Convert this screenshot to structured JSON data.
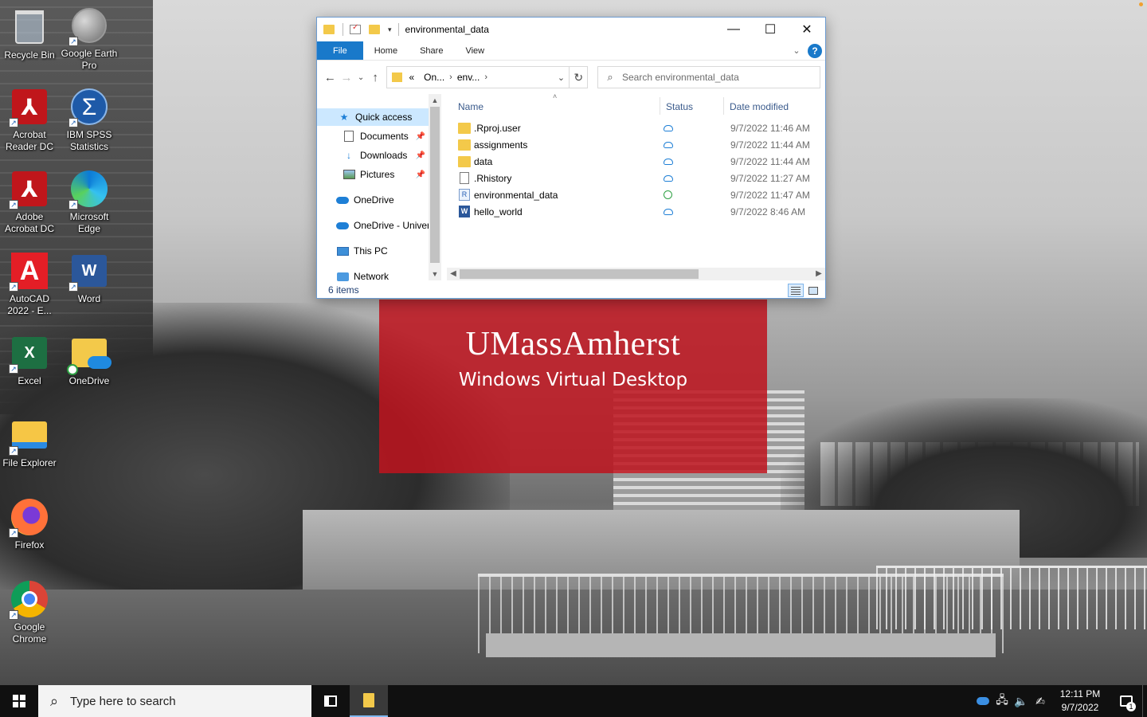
{
  "wallpaper": {
    "brand": "UMassAmherst",
    "subtitle": "Windows Virtual Desktop",
    "banner_color": "#be141e"
  },
  "desktop_icons": [
    {
      "label": "Recycle Bin",
      "icon": "recycle-bin-icon"
    },
    {
      "label": "Google Earth Pro",
      "icon": "google-earth-icon",
      "badge": "Pro"
    },
    {
      "label": "Acrobat Reader DC",
      "icon": "acrobat-reader-icon"
    },
    {
      "label": "IBM SPSS Statistics",
      "icon": "spss-icon",
      "glyph": "Σ"
    },
    {
      "label": "Adobe Acrobat DC",
      "icon": "adobe-acrobat-icon"
    },
    {
      "label": "Microsoft Edge",
      "icon": "edge-icon"
    },
    {
      "label": "AutoCAD 2022 - E...",
      "icon": "autocad-icon",
      "glyph": "A"
    },
    {
      "label": "Word",
      "icon": "word-icon",
      "glyph": "W"
    },
    {
      "label": "Excel",
      "icon": "excel-icon",
      "glyph": "X"
    },
    {
      "label": "OneDrive",
      "icon": "onedrive-folder-icon"
    },
    {
      "label": "File Explorer",
      "icon": "file-explorer-icon"
    },
    {
      "label": "Firefox",
      "icon": "firefox-icon"
    },
    {
      "label": "Google Chrome",
      "icon": "chrome-icon"
    }
  ],
  "explorer": {
    "title": "environmental_data",
    "ribbon_tabs": [
      "File",
      "Home",
      "Share",
      "View"
    ],
    "address_parts": [
      "On...",
      "env..."
    ],
    "address_prefix": "«",
    "search_placeholder": "Search environmental_data",
    "nav": {
      "quick_access": "Quick access",
      "documents": "Documents",
      "downloads": "Downloads",
      "pictures": "Pictures",
      "onedrive": "OneDrive",
      "onedrive_univ": "OneDrive - Univer",
      "this_pc": "This PC",
      "network": "Network"
    },
    "columns": {
      "name": "Name",
      "status": "Status",
      "date": "Date modified"
    },
    "files": [
      {
        "name": ".Rproj.user",
        "type": "folder",
        "status": "cloud",
        "date": "9/7/2022 11:46 AM"
      },
      {
        "name": "assignments",
        "type": "folder",
        "status": "cloud",
        "date": "9/7/2022 11:44 AM"
      },
      {
        "name": "data",
        "type": "folder",
        "status": "cloud",
        "date": "9/7/2022 11:44 AM"
      },
      {
        "name": ".Rhistory",
        "type": "file",
        "status": "cloud",
        "date": "9/7/2022 11:27 AM"
      },
      {
        "name": "environmental_data",
        "type": "rproj",
        "status": "synced",
        "date": "9/7/2022 11:47 AM"
      },
      {
        "name": "hello_world",
        "type": "word",
        "status": "cloud",
        "date": "9/7/2022 8:46 AM"
      }
    ],
    "item_count": "6 items"
  },
  "taskbar": {
    "search_placeholder": "Type here to search",
    "time": "12:11 PM",
    "date": "9/7/2022",
    "notification_count": "1"
  }
}
